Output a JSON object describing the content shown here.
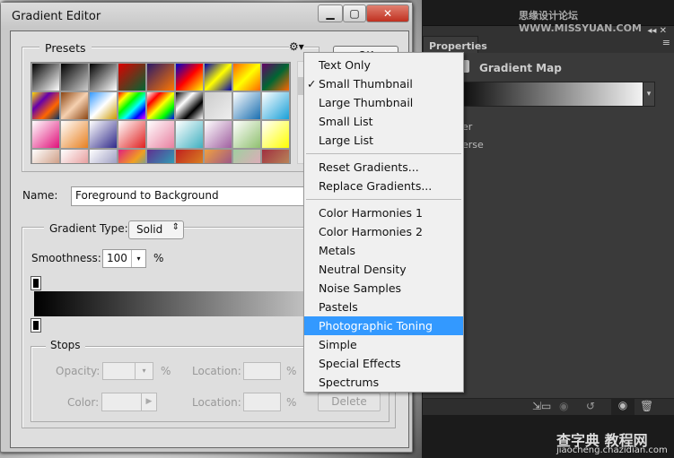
{
  "dialog": {
    "title": "Gradient Editor",
    "ok_label": "OK",
    "presets_label": "Presets",
    "name_label": "Name:",
    "name_value": "Foreground to Background",
    "gradient_type_label": "Gradient Type:",
    "gradient_type_value": "Solid",
    "smoothness_label": "Smoothness:",
    "smoothness_value": "100",
    "percent": "%",
    "stops_label": "Stops",
    "opacity_label": "Opacity:",
    "color_label": "Color:",
    "location_label": "Location:",
    "delete_label": "Delete"
  },
  "swatches": [
    [
      "#000",
      "#fff"
    ],
    [
      "#000",
      "#ccc"
    ],
    [
      "#000",
      "#fff"
    ],
    [
      "#d00",
      "#063"
    ],
    [
      "#2a1a6a",
      "#f70"
    ],
    [
      "#00c",
      "#f00",
      "#ff0"
    ],
    [
      "#00a",
      "#ff0",
      "#00a"
    ],
    [
      "#f60",
      "#ff0",
      "#f60"
    ],
    [
      "#606",
      "#063",
      "#f60"
    ],
    [
      "#fd0",
      "#60a",
      "#f60",
      "#036"
    ],
    [
      "#8b4513",
      "#f5d0b0",
      "#8b4513"
    ],
    [
      "#39f",
      "#fff",
      "#c90"
    ],
    [
      "#f00",
      "#ff0",
      "#0f0",
      "#0ff",
      "#00f",
      "#f0f"
    ],
    [
      "#fff",
      "#f00",
      "#ff0",
      "#0f0",
      "#00f"
    ],
    [
      "#000",
      "#fff",
      "#000",
      "#fff"
    ],
    [
      "#ccc",
      "#eee"
    ],
    [
      "#fff",
      "#1a6fb0"
    ],
    [
      "#fff",
      "#19a0d8"
    ],
    [
      "#fff",
      "#e0107a"
    ],
    [
      "#fff",
      "#e88020"
    ],
    [
      "#fff",
      "#302a8a"
    ],
    [
      "#fff",
      "#e02020"
    ],
    [
      "#fff",
      "#e880a0"
    ],
    [
      "#fff",
      "#40b0c0"
    ],
    [
      "#fff",
      "#a060a0"
    ],
    [
      "#fff",
      "#90c070"
    ],
    [
      "#fff",
      "#ff0"
    ],
    [
      "#fff",
      "#c08060"
    ],
    [
      "#fff",
      "#e08080"
    ],
    [
      "#fff",
      "#8080b0"
    ],
    [
      "#e02080",
      "#f0a020",
      "#20a0e0"
    ],
    [
      "#603090",
      "#20c0c0"
    ],
    [
      "#c02020",
      "#e0a020"
    ],
    [
      "#f0a040",
      "#8040a0"
    ],
    [
      "#a0d0a0",
      "#f0a0c0"
    ],
    [
      "#a03040",
      "#c0a060"
    ]
  ],
  "menu": {
    "items": [
      {
        "label": "Text Only"
      },
      {
        "label": "Small Thumbnail",
        "checked": true
      },
      {
        "label": "Large Thumbnail"
      },
      {
        "label": "Small List"
      },
      {
        "label": "Large List"
      },
      {
        "sep": true
      },
      {
        "label": "Reset Gradients..."
      },
      {
        "label": "Replace Gradients..."
      },
      {
        "sep": true
      },
      {
        "label": "Color Harmonies 1"
      },
      {
        "label": "Color Harmonies 2"
      },
      {
        "label": "Metals"
      },
      {
        "label": "Neutral Density"
      },
      {
        "label": "Noise Samples"
      },
      {
        "label": "Pastels"
      },
      {
        "label": "Photographic Toning",
        "highlighted": true
      },
      {
        "label": "Simple"
      },
      {
        "label": "Special Effects"
      },
      {
        "label": "Spectrums"
      }
    ],
    "highlight_color": "#3399ff"
  },
  "properties": {
    "tab": "Properties",
    "title": "Gradient Map",
    "opt1": "er",
    "opt2": "erse"
  },
  "watermarks": {
    "top": "思缘设计论坛 WWW.MISSYUAN.COM",
    "bottom1": "查字典 教程网",
    "bottom2": "jiaocheng.chazidian.com"
  }
}
